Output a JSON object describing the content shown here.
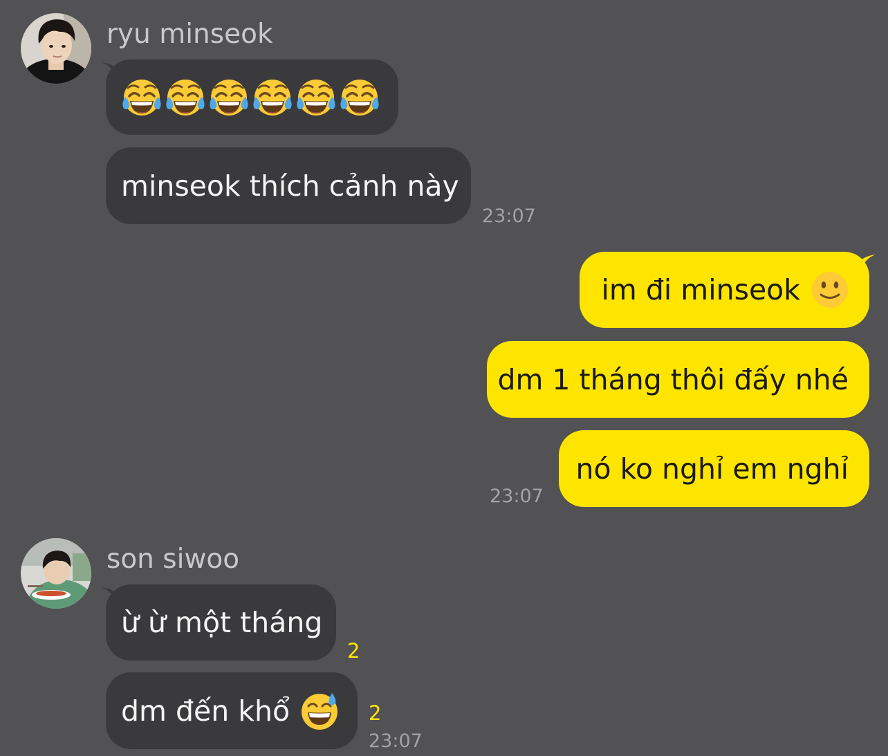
{
  "messages": {
    "group1": {
      "sender": "ryu minseok",
      "avatar": "profile-photo",
      "emoji_message": {
        "icon": "face-with-tears-of-joy-icon",
        "count": 6
      },
      "text_message": "minseok thích cảnh này",
      "time": "23:07"
    },
    "group2": {
      "messages": [
        {
          "text": "im đi minseok",
          "icon": "slightly-smiling-face-icon"
        },
        {
          "text": "dm 1 tháng thôi đấy nhé"
        },
        {
          "text": "nó ko nghỉ em nghỉ"
        }
      ],
      "time": "23:07"
    },
    "group3": {
      "sender": "son siwoo",
      "avatar": "profile-photo",
      "messages": [
        {
          "text": "ừ ừ một tháng",
          "unread": "2"
        },
        {
          "text": "dm đến khổ",
          "icon": "grinning-face-with-sweat-icon",
          "unread": "2"
        }
      ],
      "time": "23:07"
    }
  },
  "colors": {
    "background": "#525153",
    "incoming_bubble": "#3a3a3c",
    "outgoing_bubble": "#fee500",
    "unread_count": "#fee500"
  }
}
